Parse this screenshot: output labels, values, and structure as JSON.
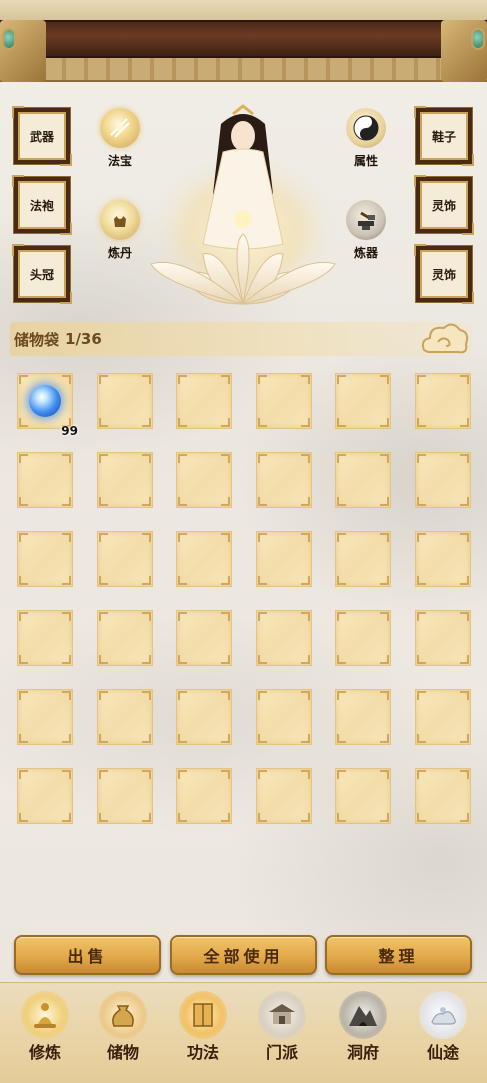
{
  "equipment": {
    "left": [
      "武器",
      "法袍",
      "头冠"
    ],
    "right": [
      "鞋子",
      "灵饰",
      "灵饰"
    ]
  },
  "orbs": {
    "left": [
      {
        "label": "法宝",
        "icon": "treasure-orb-icon"
      },
      {
        "label": "炼丹",
        "icon": "alchemy-orb-icon"
      }
    ],
    "right": [
      {
        "label": "属性",
        "icon": "yin-yang-icon"
      },
      {
        "label": "炼器",
        "icon": "forge-anvil-icon"
      }
    ]
  },
  "bag": {
    "title": "储物袋",
    "count": "1/36",
    "items": [
      {
        "slot": 0,
        "icon": "blue-spirit-orb-icon",
        "quantity": "99"
      }
    ]
  },
  "actions": {
    "sell": "出售",
    "use_all": "全部使用",
    "sort": "整理"
  },
  "nav": [
    {
      "label": "修炼",
      "icon": "meditation-icon"
    },
    {
      "label": "储物",
      "icon": "bag-icon"
    },
    {
      "label": "功法",
      "icon": "scroll-book-icon"
    },
    {
      "label": "门派",
      "icon": "temple-icon"
    },
    {
      "label": "洞府",
      "icon": "cave-mountain-icon"
    },
    {
      "label": "仙途",
      "icon": "immortal-path-icon"
    }
  ],
  "colors": {
    "accent_gold": "#e2a94a",
    "wood_dark": "#4b2a14",
    "cell_fill": "#f3ddaa"
  }
}
